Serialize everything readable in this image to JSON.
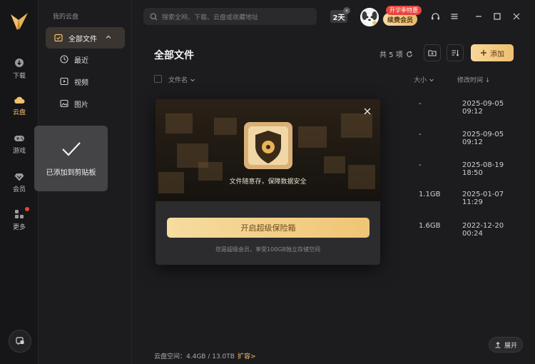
{
  "rail": {
    "items": [
      {
        "label": "下载",
        "icon": "download-icon"
      },
      {
        "label": "云盘",
        "icon": "cloud-icon"
      },
      {
        "label": "游戏",
        "icon": "gamepad-icon"
      },
      {
        "label": "会员",
        "icon": "diamond-icon"
      },
      {
        "label": "更多",
        "icon": "grid-icon"
      }
    ]
  },
  "sidebar": {
    "section_title": "我的云盘",
    "items": [
      {
        "label": "全部文件",
        "icon": "folder-icon"
      },
      {
        "label": "最近",
        "icon": "clock-icon"
      },
      {
        "label": "视频",
        "icon": "video-icon"
      },
      {
        "label": "图片",
        "icon": "image-icon"
      }
    ]
  },
  "toast": {
    "text": "已添加到剪贴板"
  },
  "topbar": {
    "search_placeholder": "搜索全网、下载、云盘或收藏地址",
    "days_badge": "2天",
    "days_close": "×",
    "promo_tag": "开学季特惠",
    "renew_label": "续费会员"
  },
  "main": {
    "title": "全部文件",
    "count": "共 5 项",
    "add_label": "添加",
    "columns": {
      "name": "文件名",
      "size": "大小",
      "time": "修改时间 ↓"
    },
    "rows": [
      {
        "size": "-",
        "time": "2025-09-05 09:12"
      },
      {
        "size": "-",
        "time": "2025-09-05 09:12"
      },
      {
        "size": "-",
        "time": "2025-08-19 18:50"
      },
      {
        "size": "1.1GB",
        "time": "2025-01-07 11:29"
      },
      {
        "size": "1.6GB",
        "time": "2022-12-20 00:24"
      }
    ],
    "storage": "云盘空间：4.4GB / 13.0TB",
    "expand_storage": "扩容>",
    "expand_label": "展开"
  },
  "modal": {
    "banner_caption": "文件随意存，保障数据安全",
    "open_button": "开启超级保险箱",
    "note": "您是超级会员，享受100GB独立存储空间"
  },
  "colors": {
    "accent": "#f4c06a",
    "background": "#1c1c1f",
    "sidebar_selected": "#3a3530"
  }
}
